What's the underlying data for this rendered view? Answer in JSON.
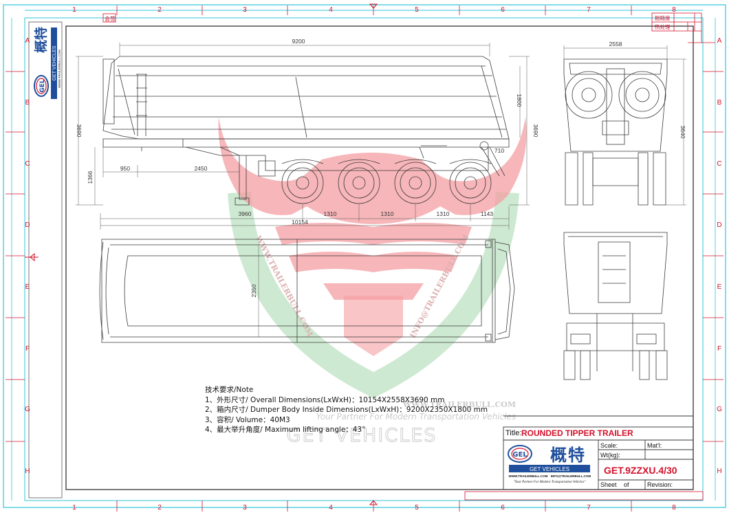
{
  "frame": {
    "columns": [
      "1",
      "2",
      "3",
      "4",
      "5",
      "6",
      "7",
      "8"
    ],
    "rows": [
      "A",
      "B",
      "C",
      "D",
      "E",
      "F",
      "G",
      "H"
    ],
    "top_left_tag": "会签",
    "top_right_tags": [
      "粗糙度",
      "热处理"
    ]
  },
  "logo": {
    "mark": "GEL",
    "chinese_name": "概特",
    "brand": "GET VEHICLES",
    "website": "WWW.TRAILERBULL.COM",
    "email": "INFO@TRAILERBULL.COM",
    "slogan": "\"Your Partner For Modern Transportation Vehicles\""
  },
  "watermark": {
    "brand_text": "GET VEHICLES",
    "url_left": "WWW.TRAILERBULL.COM",
    "url_right": "INFO@TRAILERBULL.COM",
    "url_bottom": "WWW.TRAILERBULL.COM",
    "slogan": "Your Partner For Modern Transportation Vehicles"
  },
  "dimensions": {
    "side_total_length": "9200",
    "body_height": "1800",
    "overall_height": "3690",
    "front_overhang": "950",
    "kingpin_to_frame": "2450",
    "side_ground_height": "1366",
    "rear_bracket": "710",
    "kingpin_to_axle": "3960",
    "axle_spacing_1": "1310",
    "axle_spacing_2": "1310",
    "axle_spacing_3": "1310",
    "rear_overhang": "1143",
    "overall_length": "10154",
    "top_view_width": "2350",
    "end_view_width": "2558",
    "end_view_height": "3640"
  },
  "notes": {
    "heading": "技术要求/Note",
    "items": [
      "1、外形尺寸/ Overall Dimensions(LxWxH)：10154X2558X3690 mm",
      "2、箱内尺寸/ Dumper Body Inside Dimensions(LxWxH)：9200X2350X1800 mm",
      "3、容积/ Volume：40M3",
      "4、最大举升角度/ Maximum lifting angle：43°"
    ]
  },
  "title_block": {
    "title_label": "Title:",
    "title": "ROUNDED TIPPER TRAILER",
    "scale_label": "Scale:",
    "material_label": "Mat'l:",
    "weight_label": "Wt(kg):",
    "drawing_no": "GET.9ZZXU.4/30",
    "sheet_label": "Sheet",
    "of_label": "of",
    "revision_label": "Revision:"
  },
  "colors": {
    "line": "#3a3a3a",
    "frame_red": "#d2102a",
    "frame_cyan": "#2cc6d8",
    "watermark_red": "#ec4f56",
    "watermark_green": "#5db86a",
    "logo_blue": "#1f4f9c"
  }
}
